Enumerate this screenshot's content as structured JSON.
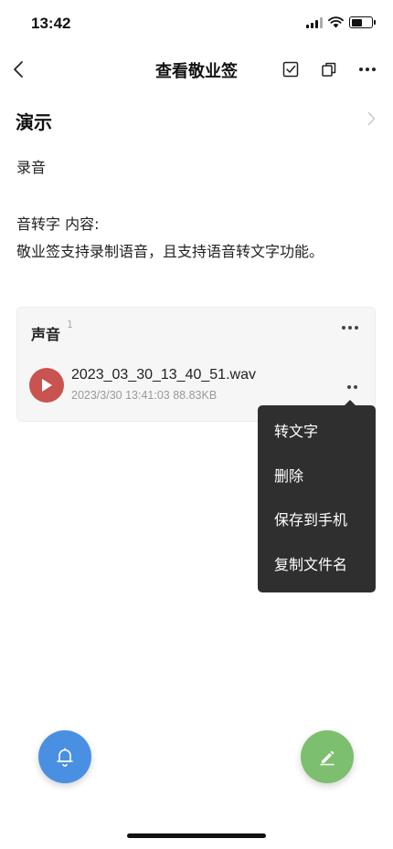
{
  "status_bar": {
    "time": "13:42"
  },
  "nav": {
    "title": "查看敬业签"
  },
  "note": {
    "title": "演示",
    "lines": [
      "录音",
      "音转字 内容:",
      "敬业签支持录制语音，且支持语音转文字功能。"
    ]
  },
  "sound_section": {
    "heading": "声音",
    "count": "1",
    "files": [
      {
        "name": "2023_03_30_13_40_51.wav",
        "meta": "2023/3/30 13:41:03  88.83KB"
      }
    ]
  },
  "context_menu": {
    "items": [
      "转文字",
      "删除",
      "保存到手机",
      "复制文件名"
    ]
  },
  "colors": {
    "play_button": "#c9534f",
    "reminder_fab": "#4a90e2",
    "edit_fab": "#7cbf6e",
    "menu_background": "#2f2f2f"
  },
  "icons": {
    "back": "chevron-left-icon",
    "check": "checkbox-icon",
    "copy": "copy-icon",
    "more": "more-horizontal-icon",
    "chevron": "chevron-right-icon",
    "play": "play-icon",
    "bell": "bell-icon",
    "edit": "pen-icon"
  }
}
